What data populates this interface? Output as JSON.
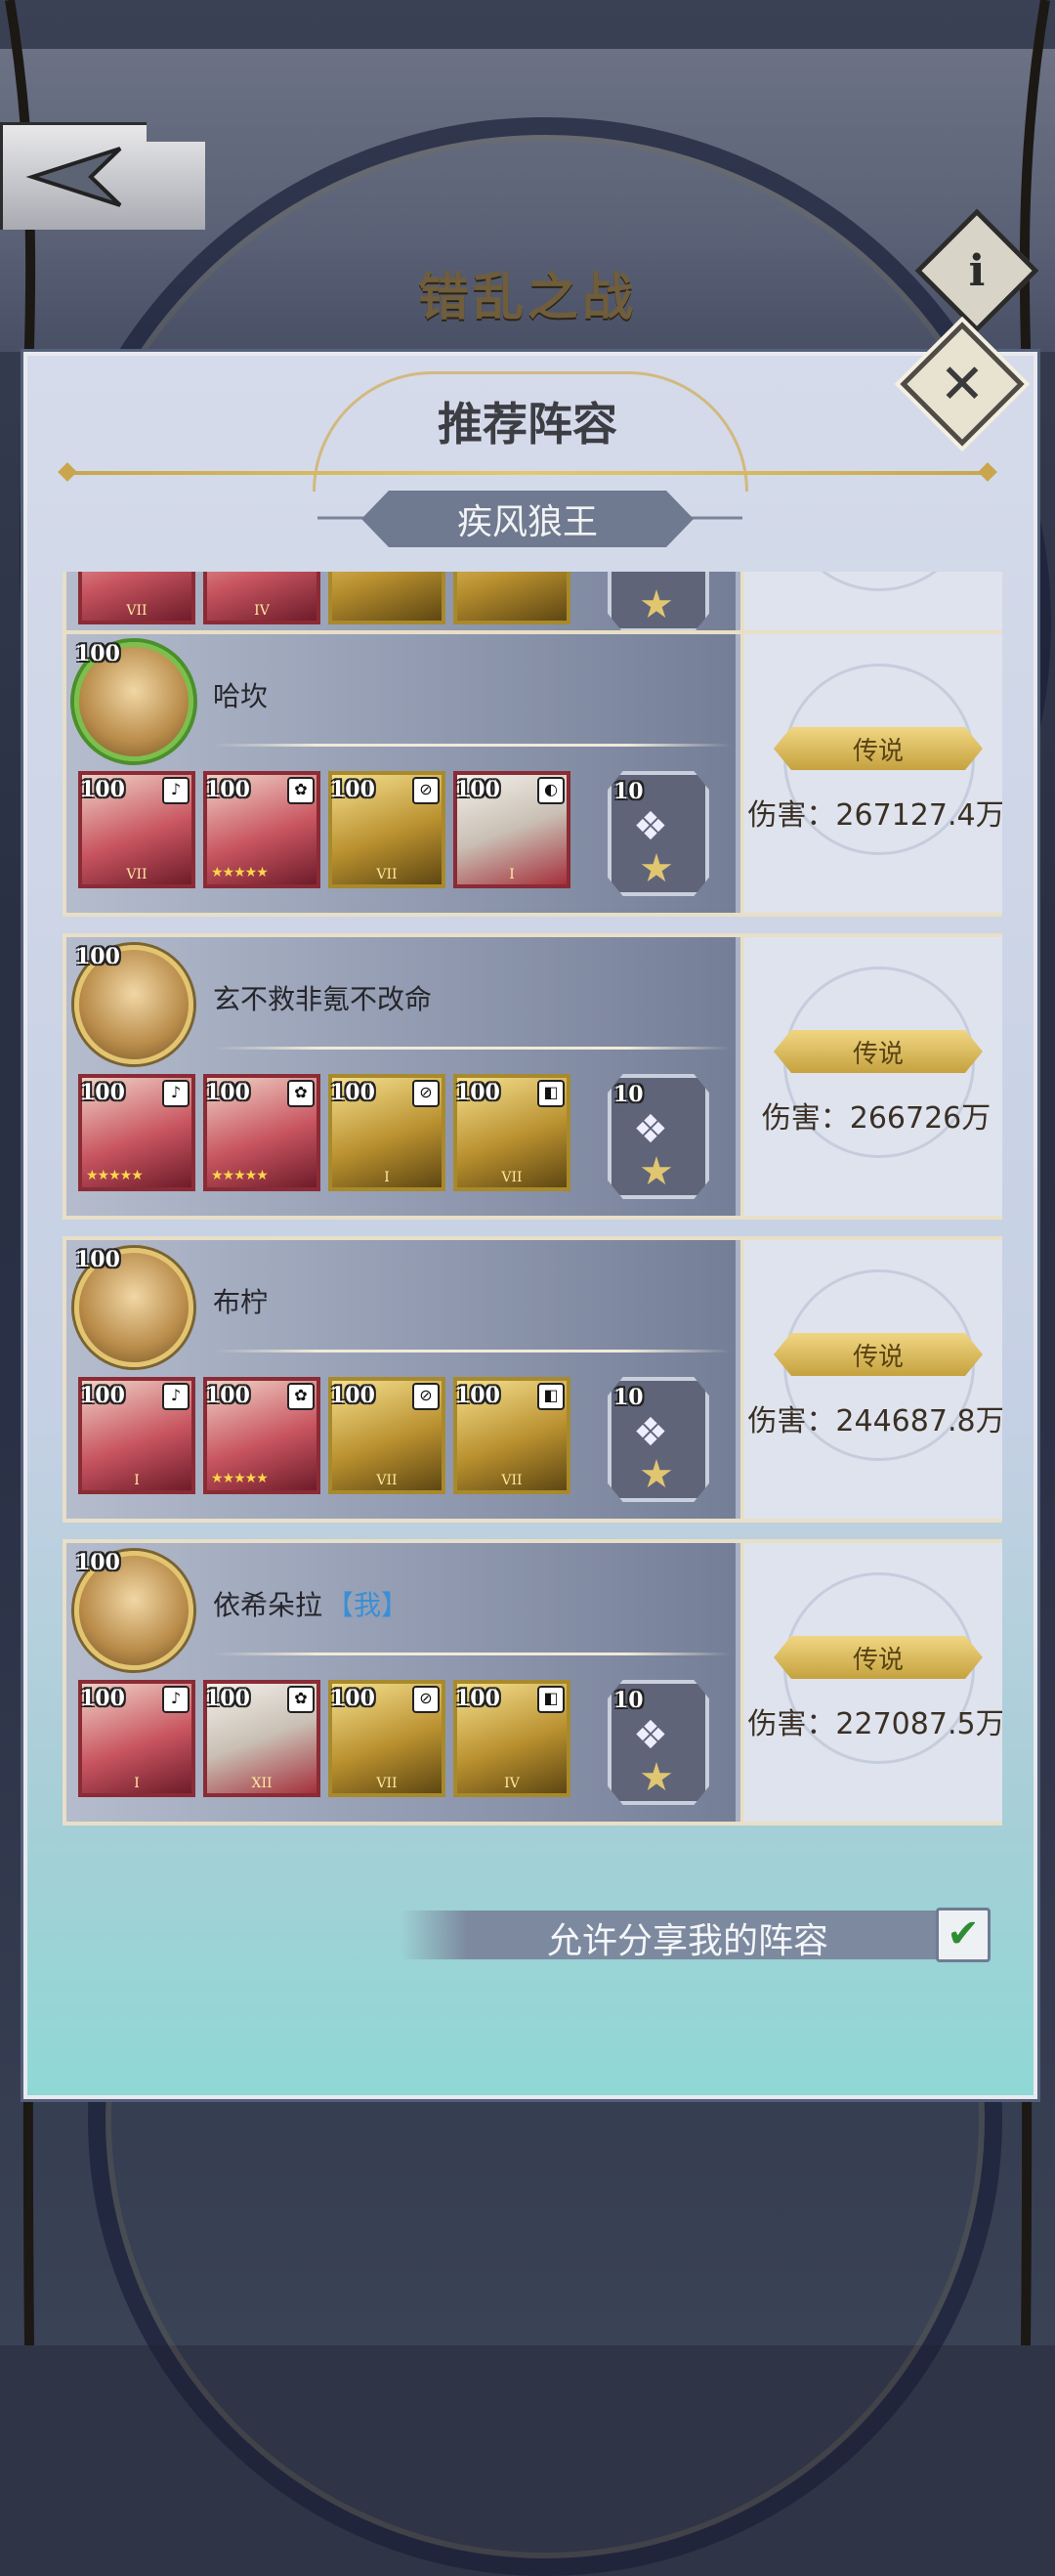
{
  "header": {
    "back_label": "",
    "scene_title": "错乱之战",
    "info_icon": "i"
  },
  "dialog": {
    "title": "推荐阵容",
    "boss_name": "疾风狼王",
    "close_icon": "✕"
  },
  "lineups": [
    {
      "player": "哈坎",
      "is_me": false,
      "avatar_level": "100",
      "heroes": [
        {
          "level": "100",
          "style": "red",
          "symbol": "♪",
          "stars": "",
          "rank": "VII"
        },
        {
          "level": "100",
          "style": "red",
          "symbol": "✿",
          "stars": "★★★★★",
          "rank": ""
        },
        {
          "level": "100",
          "style": "gold",
          "symbol": "⊘",
          "stars": "",
          "rank": "VII"
        },
        {
          "level": "100",
          "style": "silver",
          "symbol": "◐",
          "stars": "",
          "rank": "I"
        }
      ],
      "pet_level": "10",
      "rating": "传说",
      "damage": "伤害：267127.4万"
    },
    {
      "player": "玄不救非氪不改命",
      "is_me": false,
      "avatar_level": "100",
      "heroes": [
        {
          "level": "100",
          "style": "red",
          "symbol": "♪",
          "stars": "★★★★★",
          "rank": ""
        },
        {
          "level": "100",
          "style": "red",
          "symbol": "✿",
          "stars": "★★★★★",
          "rank": ""
        },
        {
          "level": "100",
          "style": "gold",
          "symbol": "⊘",
          "stars": "",
          "rank": "I"
        },
        {
          "level": "100",
          "style": "gold",
          "symbol": "◧",
          "stars": "",
          "rank": "VII"
        }
      ],
      "pet_level": "10",
      "rating": "传说",
      "damage": "伤害：266726万"
    },
    {
      "player": "布柠",
      "is_me": false,
      "avatar_level": "100",
      "heroes": [
        {
          "level": "100",
          "style": "red",
          "symbol": "♪",
          "stars": "",
          "rank": "I"
        },
        {
          "level": "100",
          "style": "red",
          "symbol": "✿",
          "stars": "★★★★★",
          "rank": ""
        },
        {
          "level": "100",
          "style": "gold",
          "symbol": "⊘",
          "stars": "",
          "rank": "VII"
        },
        {
          "level": "100",
          "style": "gold",
          "symbol": "◧",
          "stars": "",
          "rank": "VII"
        }
      ],
      "pet_level": "10",
      "rating": "传说",
      "damage": "伤害：244687.8万"
    },
    {
      "player": "依希朵拉",
      "is_me": true,
      "me_tag": "【我】",
      "avatar_level": "100",
      "heroes": [
        {
          "level": "100",
          "style": "red",
          "symbol": "♪",
          "stars": "",
          "rank": "I"
        },
        {
          "level": "100",
          "style": "silver",
          "symbol": "✿",
          "stars": "",
          "rank": "XII"
        },
        {
          "level": "100",
          "style": "gold",
          "symbol": "⊘",
          "stars": "",
          "rank": "VII"
        },
        {
          "level": "100",
          "style": "gold",
          "symbol": "◧",
          "stars": "",
          "rank": "IV"
        }
      ],
      "pet_level": "10",
      "rating": "传说",
      "damage": "伤害：227087.5万"
    }
  ],
  "partial_top_ranks": [
    "VII",
    "IV",
    "",
    ""
  ],
  "share": {
    "label": "允许分享我的阵容",
    "checked": true,
    "check_icon": "✔"
  }
}
